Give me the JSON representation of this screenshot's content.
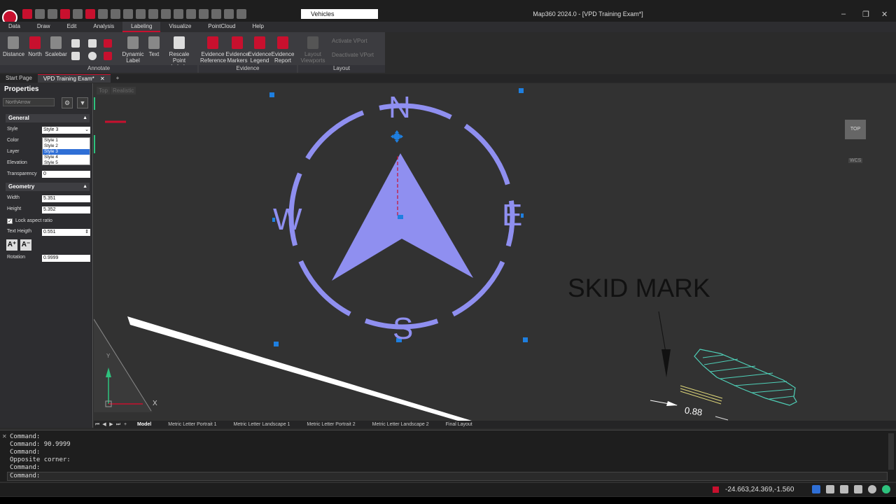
{
  "window": {
    "title": "Map360 2024.0 - [VPD Training Exam*]",
    "layer_combo": "Vehicles",
    "controls": {
      "minimize": "–",
      "restore": "❐",
      "close": "✕"
    }
  },
  "ribbon": {
    "tabs": [
      "Data",
      "Draw",
      "Edit",
      "Analysis",
      "Labeling",
      "Visualize",
      "PointCloud",
      "Help"
    ],
    "active_tab": "Labeling",
    "buttons": {
      "distance": "Distance",
      "north": "North",
      "scalebar": "Scalebar",
      "dynamic_label_1": "Dynamic",
      "dynamic_label_2": "Label",
      "text": "Text",
      "rescale_1": "Rescale",
      "rescale_2": "Point Labels",
      "ev_ref_1": "Evidence",
      "ev_ref_2": "Reference",
      "ev_mark_1": "Evidence",
      "ev_mark_2": "Markers",
      "ev_leg_1": "Evidence",
      "ev_leg_2": "Legend",
      "ev_rep_1": "Evidence",
      "ev_rep_2": "Report",
      "layout_vp_1": "Layout",
      "layout_vp_2": "Viewports",
      "activate_vport": "Activate VPort",
      "deactivate_vport": "Deactivate VPort"
    },
    "groups": {
      "annotate": "Annotate",
      "evidence": "Evidence",
      "layout": "Layout"
    }
  },
  "doc_tabs": {
    "start": "Start Page",
    "active": "VPD Training Exam*",
    "close": "✕",
    "add": "+"
  },
  "properties": {
    "title": "Properties",
    "close": "✕",
    "object_type": "NorthArrow",
    "general_header": "General",
    "geometry_header": "Geometry",
    "labels": {
      "style": "Style",
      "color": "Color",
      "layer": "Layer",
      "elevation": "Elevation",
      "transparency": "Transparency",
      "width": "Width",
      "height": "Height",
      "lock_aspect": "Lock aspect ratio",
      "text_height": "Text Heigth",
      "rotation": "Rotation"
    },
    "values": {
      "style": "Style 3",
      "transparency": "0",
      "width": "5.351",
      "height": "5.352",
      "text_height": "0.551",
      "rotation": "0.9999"
    },
    "style_options": [
      "Style 1",
      "Style 2",
      "Style 3",
      "Style 4",
      "Style 5"
    ],
    "selected_option": "Style 3",
    "text_buttons": [
      "A⁺",
      "A⁻"
    ]
  },
  "canvas": {
    "view_labels": [
      "Top",
      "Realistic"
    ],
    "navcube": "TOP",
    "wcs": "WCS",
    "compass_letters": {
      "n": "N",
      "s": "S",
      "e": "E",
      "w": "W"
    },
    "skid_label": "SKID MARK",
    "dimension": "0.88",
    "ucs_y": "Y",
    "ucs_x": "X",
    "colors": {
      "compass": "#8f8ff0",
      "grip": "#1e7fe0",
      "hatch": "#4fd0b8"
    }
  },
  "layout_tabs": {
    "nav": [
      "⏮",
      "◀",
      "▶",
      "⏭",
      "+"
    ],
    "tabs": [
      "Model",
      "Metric Letter Portrait 1",
      "Metric Letter Landscape 1",
      "Metric Letter Portrait 2",
      "Metric Letter Landscape 2",
      "Final Layout"
    ],
    "active": "Model"
  },
  "command": {
    "history": [
      "Command:",
      "Command: 90.9999",
      "Command:",
      "Opposite corner:",
      "Command:"
    ],
    "prompt": "Command:"
  },
  "status": {
    "coords": "-24.663,24.369,-1.560"
  }
}
